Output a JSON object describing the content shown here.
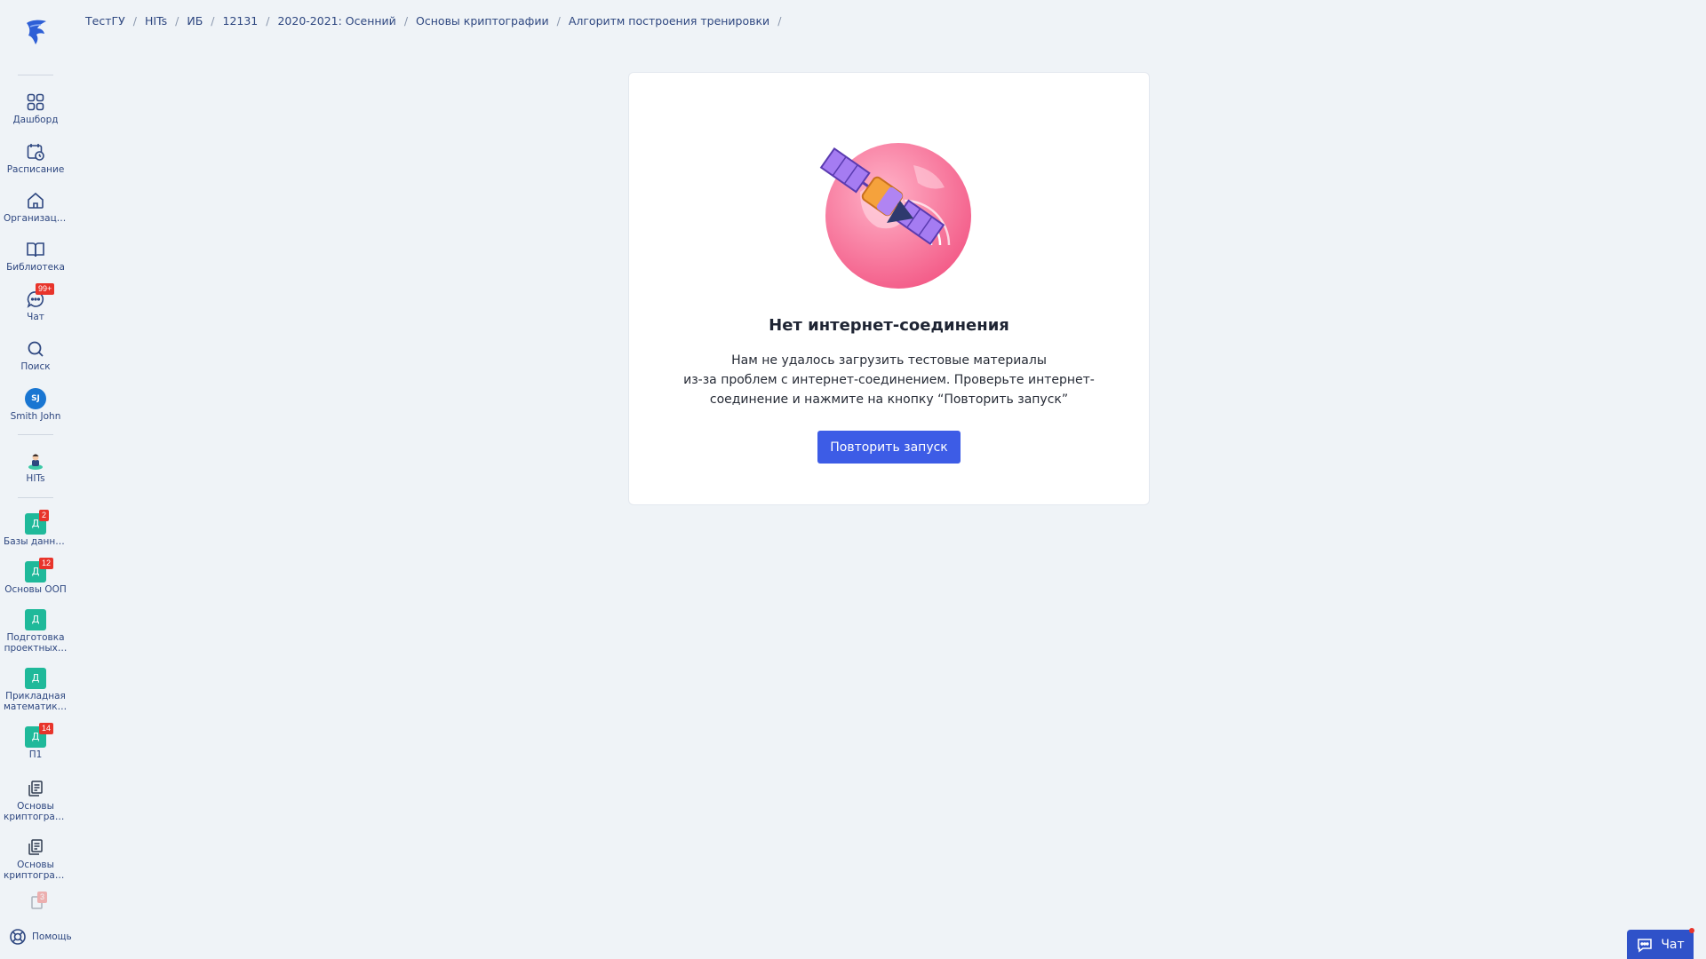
{
  "breadcrumb": [
    "ТестГУ",
    "HITs",
    "ИБ",
    "12131",
    "2020-2021: Осенний",
    "Основы криптографии",
    "Алгоритм построения тренировки"
  ],
  "sidebar": {
    "main": [
      {
        "label": "Дашборд",
        "icon": "grid-icon"
      },
      {
        "label": "Расписание",
        "icon": "calendar-clock-icon"
      },
      {
        "label": "Организация",
        "icon": "home-icon"
      },
      {
        "label": "Библиотека",
        "icon": "book-icon"
      },
      {
        "label": "Чат",
        "icon": "chat-icon",
        "badge": "99+"
      },
      {
        "label": "Поиск",
        "icon": "search-icon"
      }
    ],
    "user": {
      "initials": "SJ",
      "label": "Smith John"
    },
    "org": {
      "label": "HITs",
      "icon": "mascot-icon"
    },
    "courses": [
      {
        "letter": "Д",
        "label": "Базы данных",
        "badge": "2"
      },
      {
        "letter": "Д",
        "label": "Основы ООП",
        "badge": "12"
      },
      {
        "letter": "Д",
        "label": "Подготовка проектных…",
        "badge": ""
      },
      {
        "letter": "Д",
        "label": "Прикладная математика…",
        "badge": ""
      },
      {
        "letter": "Д",
        "label": "П1",
        "badge": "14"
      }
    ],
    "docs": [
      {
        "label": "Основы криптограф…",
        "icon": "documents-icon"
      },
      {
        "label": "Основы криптограф…",
        "icon": "documents-icon"
      }
    ],
    "faded_badge": "3",
    "help_label": "Помощь"
  },
  "card": {
    "title": "Нет интернет-соединения",
    "message_line1": "Нам не удалось загрузить тестовые материалы",
    "message_line2": "из-за проблем с интернет-соединением. Проверьте интернет-",
    "message_line3": "соединение и нажмите на кнопку “Повторить запуск”",
    "retry_label": "Повторить запуск"
  },
  "chat_widget": {
    "label": "Чат"
  },
  "colors": {
    "accent": "#3d5ce6",
    "course": "#1fb99a",
    "badge": "#e8342b",
    "nav_text": "#2e4780"
  }
}
